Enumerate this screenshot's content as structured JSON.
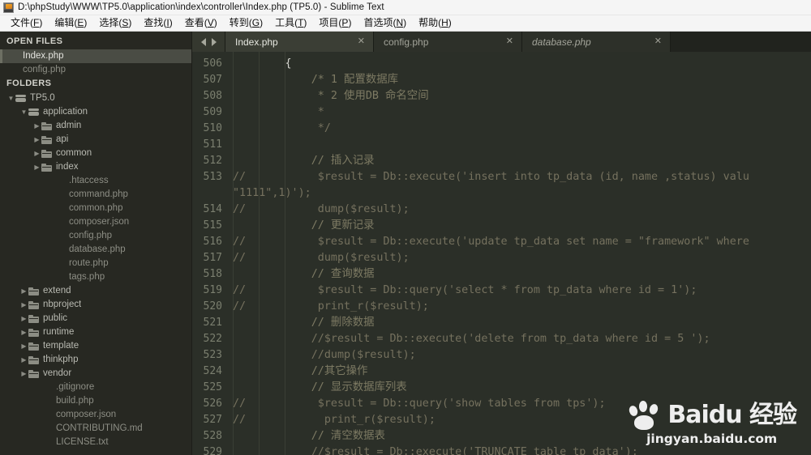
{
  "window": {
    "title": "D:\\phpStudy\\WWW\\TP5.0\\application\\index\\controller\\Index.php (TP5.0) - Sublime Text",
    "app_icon": "sublime-text-icon"
  },
  "menubar": {
    "items": [
      {
        "label": "文件(F)",
        "mnemonic": "F"
      },
      {
        "label": "编辑(E)",
        "mnemonic": "E"
      },
      {
        "label": "选择(S)",
        "mnemonic": "S"
      },
      {
        "label": "查找(I)",
        "mnemonic": "I"
      },
      {
        "label": "查看(V)",
        "mnemonic": "V"
      },
      {
        "label": "转到(G)",
        "mnemonic": "G"
      },
      {
        "label": "工具(T)",
        "mnemonic": "T"
      },
      {
        "label": "项目(P)",
        "mnemonic": "P"
      },
      {
        "label": "首选项(N)",
        "mnemonic": "N"
      },
      {
        "label": "帮助(H)",
        "mnemonic": "H"
      }
    ]
  },
  "sidebar": {
    "open_files_header": "OPEN FILES",
    "folders_header": "FOLDERS",
    "open_files": [
      {
        "label": "Index.php",
        "selected": true
      },
      {
        "label": "config.php",
        "selected": false
      }
    ],
    "tree": [
      {
        "label": "TP5.0",
        "indent": 0,
        "type": "folder-root",
        "twisty": "▼"
      },
      {
        "label": "application",
        "indent": 1,
        "type": "folder-root",
        "twisty": "▼"
      },
      {
        "label": "admin",
        "indent": 2,
        "type": "folder",
        "twisty": "▶"
      },
      {
        "label": "api",
        "indent": 2,
        "type": "folder",
        "twisty": "▶"
      },
      {
        "label": "common",
        "indent": 2,
        "type": "folder",
        "twisty": "▶"
      },
      {
        "label": "index",
        "indent": 2,
        "type": "folder",
        "twisty": "▶"
      },
      {
        "label": ".htaccess",
        "indent": 3,
        "type": "file",
        "twisty": ""
      },
      {
        "label": "command.php",
        "indent": 3,
        "type": "file",
        "twisty": ""
      },
      {
        "label": "common.php",
        "indent": 3,
        "type": "file",
        "twisty": ""
      },
      {
        "label": "composer.json",
        "indent": 3,
        "type": "file",
        "twisty": ""
      },
      {
        "label": "config.php",
        "indent": 3,
        "type": "file",
        "twisty": ""
      },
      {
        "label": "database.php",
        "indent": 3,
        "type": "file",
        "twisty": ""
      },
      {
        "label": "route.php",
        "indent": 3,
        "type": "file",
        "twisty": ""
      },
      {
        "label": "tags.php",
        "indent": 3,
        "type": "file",
        "twisty": ""
      },
      {
        "label": "extend",
        "indent": 1,
        "type": "folder",
        "twisty": "▶"
      },
      {
        "label": "nbproject",
        "indent": 1,
        "type": "folder",
        "twisty": "▶"
      },
      {
        "label": "public",
        "indent": 1,
        "type": "folder",
        "twisty": "▶"
      },
      {
        "label": "runtime",
        "indent": 1,
        "type": "folder",
        "twisty": "▶"
      },
      {
        "label": "template",
        "indent": 1,
        "type": "folder",
        "twisty": "▶"
      },
      {
        "label": "thinkphp",
        "indent": 1,
        "type": "folder",
        "twisty": "▶"
      },
      {
        "label": "vendor",
        "indent": 1,
        "type": "folder",
        "twisty": "▶"
      },
      {
        "label": ".gitignore",
        "indent": 2,
        "type": "file",
        "twisty": ""
      },
      {
        "label": "build.php",
        "indent": 2,
        "type": "file",
        "twisty": ""
      },
      {
        "label": "composer.json",
        "indent": 2,
        "type": "file",
        "twisty": ""
      },
      {
        "label": "CONTRIBUTING.md",
        "indent": 2,
        "type": "file",
        "twisty": ""
      },
      {
        "label": "LICENSE.txt",
        "indent": 2,
        "type": "file",
        "twisty": ""
      }
    ]
  },
  "tabbar": {
    "prev_icon": "arrow-left-icon",
    "next_icon": "arrow-right-icon",
    "close_glyph": "✕",
    "tabs": [
      {
        "label": "Index.php",
        "active": true,
        "preview": false
      },
      {
        "label": "config.php",
        "active": false,
        "preview": false
      },
      {
        "label": "database.php",
        "active": false,
        "preview": true
      }
    ]
  },
  "editor": {
    "first_line": 506,
    "lines": [
      {
        "num": "506",
        "tokens": [
          {
            "t": "        ",
            "c": "plain"
          },
          {
            "t": "{",
            "c": "punct"
          }
        ]
      },
      {
        "num": "507",
        "tokens": [
          {
            "t": "            /* 1 配置数据库",
            "c": "comment-cn"
          }
        ]
      },
      {
        "num": "508",
        "tokens": [
          {
            "t": "             * 2 使用DB 命名空间",
            "c": "comment-cn"
          }
        ]
      },
      {
        "num": "509",
        "tokens": [
          {
            "t": "             *",
            "c": "comment"
          }
        ]
      },
      {
        "num": "510",
        "tokens": [
          {
            "t": "             */",
            "c": "comment"
          }
        ]
      },
      {
        "num": "511",
        "tokens": []
      },
      {
        "num": "512",
        "tokens": [
          {
            "t": "            // 插入记录",
            "c": "comment-cn"
          }
        ]
      },
      {
        "num": "513",
        "tokens": [
          {
            "t": "//           $result = Db::execute('insert into tp_data (id, name ,status) valu",
            "c": "comment"
          }
        ],
        "wrap": "\"1111\",1)');"
      },
      {
        "num": "514",
        "tokens": [
          {
            "t": "//           dump($result);",
            "c": "comment"
          }
        ]
      },
      {
        "num": "515",
        "tokens": [
          {
            "t": "            // 更新记录",
            "c": "comment-cn"
          }
        ]
      },
      {
        "num": "516",
        "tokens": [
          {
            "t": "//           $result = Db::execute('update tp_data set name = \"framework\" where",
            "c": "comment"
          }
        ]
      },
      {
        "num": "517",
        "tokens": [
          {
            "t": "//           dump($result);",
            "c": "comment"
          }
        ]
      },
      {
        "num": "518",
        "tokens": [
          {
            "t": "            // 查询数据",
            "c": "comment-cn"
          }
        ]
      },
      {
        "num": "519",
        "tokens": [
          {
            "t": "//           $result = Db::query('select * from tp_data where id = 1');",
            "c": "comment"
          }
        ]
      },
      {
        "num": "520",
        "tokens": [
          {
            "t": "//           print_r($result);",
            "c": "comment"
          }
        ]
      },
      {
        "num": "521",
        "tokens": [
          {
            "t": "            // 删除数据",
            "c": "comment-cn"
          }
        ]
      },
      {
        "num": "522",
        "tokens": [
          {
            "t": "            //$result = Db::execute('delete from tp_data where id = 5 ');",
            "c": "comment"
          }
        ]
      },
      {
        "num": "523",
        "tokens": [
          {
            "t": "            //dump($result);",
            "c": "comment"
          }
        ]
      },
      {
        "num": "524",
        "tokens": [
          {
            "t": "            //其它操作",
            "c": "comment-cn"
          }
        ]
      },
      {
        "num": "525",
        "tokens": [
          {
            "t": "            // 显示数据库列表",
            "c": "comment-cn"
          }
        ]
      },
      {
        "num": "526",
        "tokens": [
          {
            "t": "//           $result = Db::query('show tables from tps');",
            "c": "comment"
          }
        ]
      },
      {
        "num": "527",
        "tokens": [
          {
            "t": "//            print_r($result);",
            "c": "comment"
          }
        ]
      },
      {
        "num": "528",
        "tokens": [
          {
            "t": "            // 清空数据表",
            "c": "comment-cn"
          }
        ]
      },
      {
        "num": "529",
        "tokens": [
          {
            "t": "            //$result = Db::execute('TRUNCATE table tp_data');",
            "c": "comment"
          }
        ]
      }
    ],
    "cursor_icon": "text-ibeam-cursor"
  },
  "watermark": {
    "brand": "Baidu 经验",
    "url": "jingyan.baidu.com",
    "paw_icon": "baidu-paw-icon"
  },
  "colors": {
    "titlebar_bg": "#f5f5f5",
    "sidebar_bg": "#272822",
    "editor_bg": "#2b2f28",
    "tabbar_bg": "#21231e",
    "active_tab_bg": "#3b3e35",
    "comment_fg": "#75715e",
    "gutter_fg": "#7b7f6f",
    "selection_bg": "#4a4c44"
  }
}
